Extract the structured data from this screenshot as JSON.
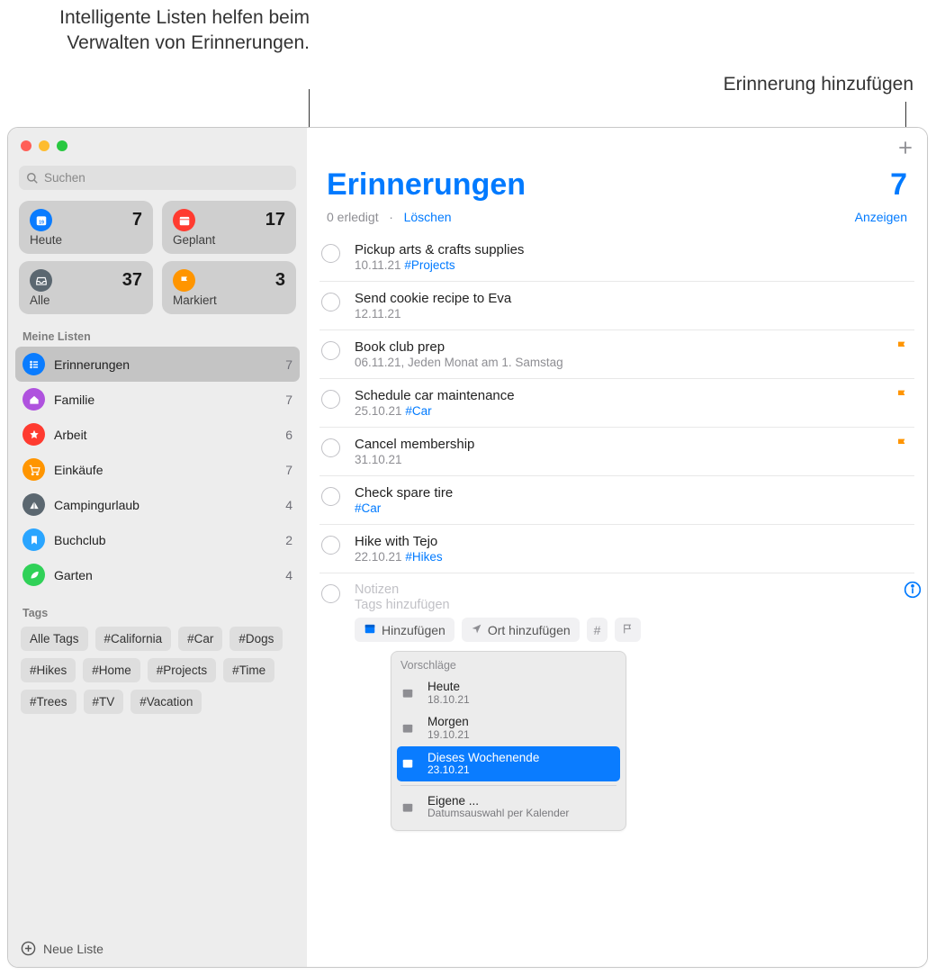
{
  "callouts": {
    "smart_lists": "Intelligente Listen helfen beim Verwalten von Erinnerungen.",
    "add_reminder": "Erinnerung hinzufügen"
  },
  "search": {
    "placeholder": "Suchen"
  },
  "smart_cards": [
    {
      "label": "Heute",
      "count": "7",
      "icon": "calendar-today-icon",
      "color": "sc-blue"
    },
    {
      "label": "Geplant",
      "count": "17",
      "icon": "calendar-icon",
      "color": "sc-red"
    },
    {
      "label": "Alle",
      "count": "37",
      "icon": "tray-icon",
      "color": "sc-gray"
    },
    {
      "label": "Markiert",
      "count": "3",
      "icon": "flag-icon",
      "color": "sc-orange"
    }
  ],
  "lists_heading": "Meine Listen",
  "lists": [
    {
      "name": "Erinnerungen",
      "count": "7",
      "icon": "list-bullet-icon",
      "color": "#0a7cff",
      "selected": true
    },
    {
      "name": "Familie",
      "count": "7",
      "icon": "house-icon",
      "color": "#af52de",
      "selected": false
    },
    {
      "name": "Arbeit",
      "count": "6",
      "icon": "star-icon",
      "color": "#ff3b30",
      "selected": false
    },
    {
      "name": "Einkäufe",
      "count": "7",
      "icon": "cart-icon",
      "color": "#ff9500",
      "selected": false
    },
    {
      "name": "Campingurlaub",
      "count": "4",
      "icon": "tent-icon",
      "color": "#5b6770",
      "selected": false
    },
    {
      "name": "Buchclub",
      "count": "2",
      "icon": "bookmark-icon",
      "color": "#2aa5ff",
      "selected": false
    },
    {
      "name": "Garten",
      "count": "4",
      "icon": "leaf-icon",
      "color": "#30d158",
      "selected": false
    }
  ],
  "tags_heading": "Tags",
  "tags": [
    "Alle Tags",
    "#California",
    "#Car",
    "#Dogs",
    "#Hikes",
    "#Home",
    "#Projects",
    "#Time",
    "#Trees",
    "#TV",
    "#Vacation"
  ],
  "new_list_label": "Neue Liste",
  "main": {
    "title": "Erinnerungen",
    "count": "7",
    "done_text": "0 erledigt",
    "dot": "·",
    "delete": "Löschen",
    "show": "Anzeigen"
  },
  "reminders": [
    {
      "title": "Pickup arts & crafts supplies",
      "sub_date": "10.11.21",
      "hash": "#Projects",
      "flagged": false
    },
    {
      "title": "Send cookie recipe to Eva",
      "sub_date": "12.11.21",
      "hash": "",
      "flagged": false
    },
    {
      "title": "Book club prep",
      "sub_date": "06.11.21, Jeden Monat am 1. Samstag",
      "hash": "",
      "flagged": true
    },
    {
      "title": "Schedule car maintenance",
      "sub_date": "25.10.21",
      "hash": "#Car",
      "flagged": true
    },
    {
      "title": "Cancel membership",
      "sub_date": "31.10.21",
      "hash": "",
      "flagged": true
    },
    {
      "title": "Check spare tire",
      "sub_date": "",
      "hash": "#Car",
      "flagged": false
    },
    {
      "title": "Hike with Tejo",
      "sub_date": "22.10.21",
      "hash": "#Hikes",
      "flagged": false
    }
  ],
  "new_reminder": {
    "notes_placeholder": "Notizen",
    "tags_placeholder": "Tags hinzufügen",
    "add_date": "Hinzufügen",
    "add_location": "Ort hinzufügen",
    "hash_label": "#",
    "flag_label": ""
  },
  "suggestions": {
    "heading": "Vorschläge",
    "items": [
      {
        "t1": "Heute",
        "t2": "18.10.21",
        "selected": false
      },
      {
        "t1": "Morgen",
        "t2": "19.10.21",
        "selected": false
      },
      {
        "t1": "Dieses Wochenende",
        "t2": "23.10.21",
        "selected": true
      },
      {
        "t1": "Eigene ...",
        "t2": "Datumsauswahl per Kalender",
        "selected": false,
        "sep_before": true
      }
    ]
  }
}
